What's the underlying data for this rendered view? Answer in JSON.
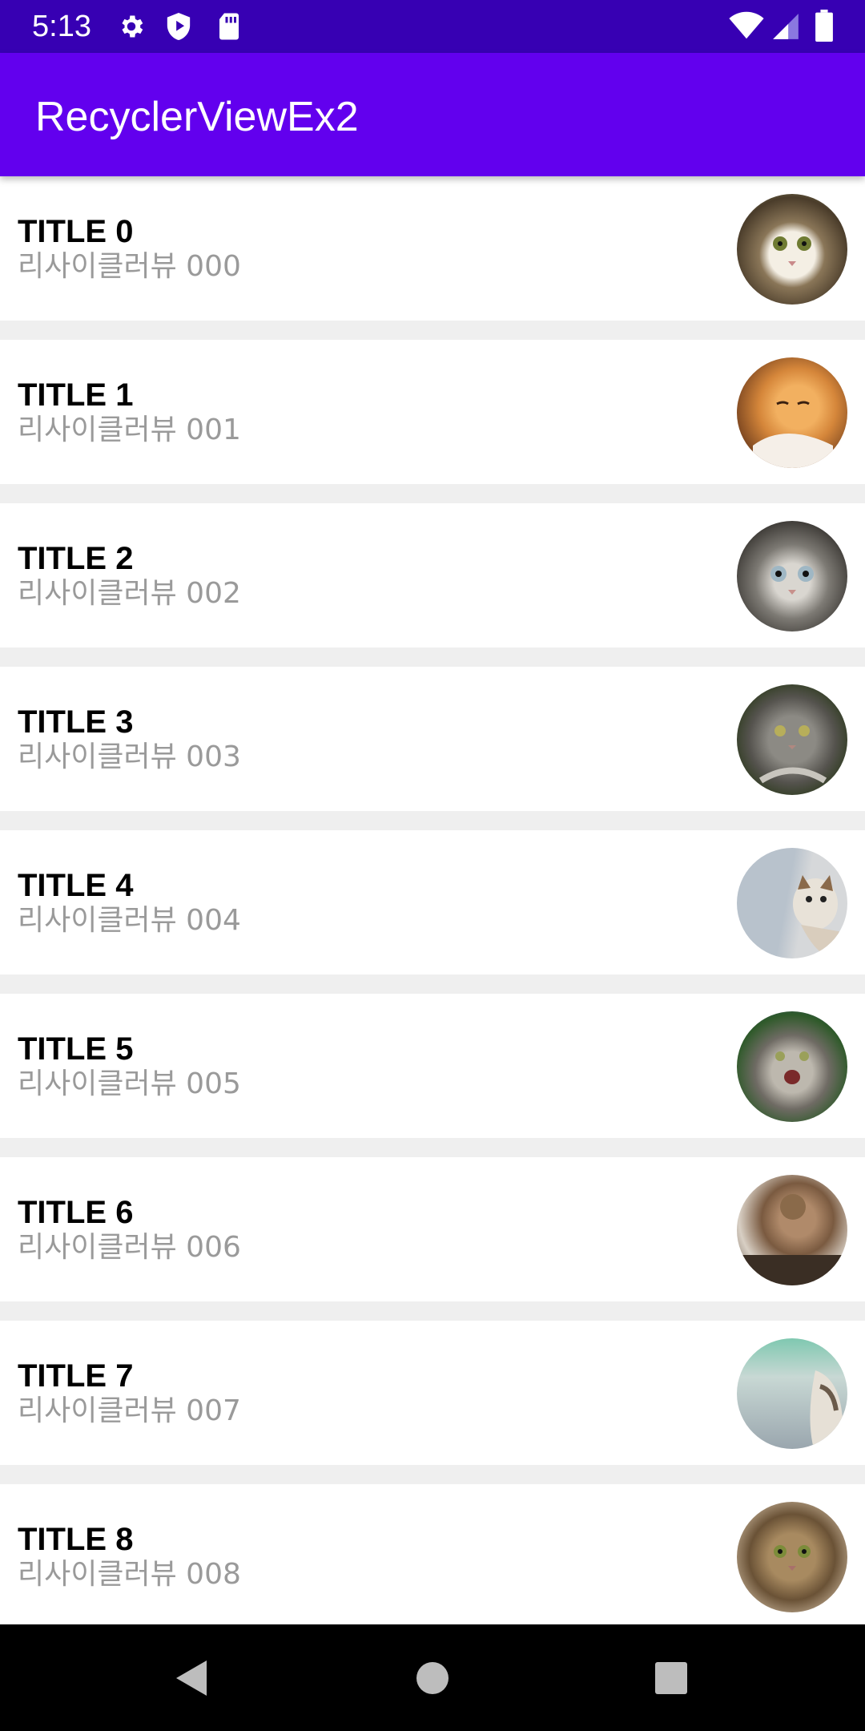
{
  "status_bar": {
    "time": "5:13",
    "icons": [
      "gear-icon",
      "shield-icon",
      "sd-card-icon",
      "wifi-icon",
      "signal-icon",
      "battery-icon"
    ]
  },
  "app_bar": {
    "title": "RecyclerViewEx2",
    "color": "#6200ee"
  },
  "list": {
    "items": [
      {
        "title": "TITLE 0",
        "subtitle": "리사이클러뷰 000",
        "avatar": "cat-photo"
      },
      {
        "title": "TITLE 1",
        "subtitle": "리사이클러뷰 001",
        "avatar": "cat-photo"
      },
      {
        "title": "TITLE 2",
        "subtitle": "리사이클러뷰 002",
        "avatar": "cat-photo"
      },
      {
        "title": "TITLE 3",
        "subtitle": "리사이클러뷰 003",
        "avatar": "cat-photo"
      },
      {
        "title": "TITLE 4",
        "subtitle": "리사이클러뷰 004",
        "avatar": "cat-photo"
      },
      {
        "title": "TITLE 5",
        "subtitle": "리사이클러뷰 005",
        "avatar": "cat-photo"
      },
      {
        "title": "TITLE 6",
        "subtitle": "리사이클러뷰 006",
        "avatar": "cat-photo"
      },
      {
        "title": "TITLE 7",
        "subtitle": "리사이클러뷰 007",
        "avatar": "cat-photo"
      },
      {
        "title": "TITLE 8",
        "subtitle": "리사이클러뷰 008",
        "avatar": "cat-photo"
      }
    ]
  },
  "nav_bar": {
    "buttons": [
      "back-icon",
      "home-icon",
      "recents-icon"
    ]
  }
}
